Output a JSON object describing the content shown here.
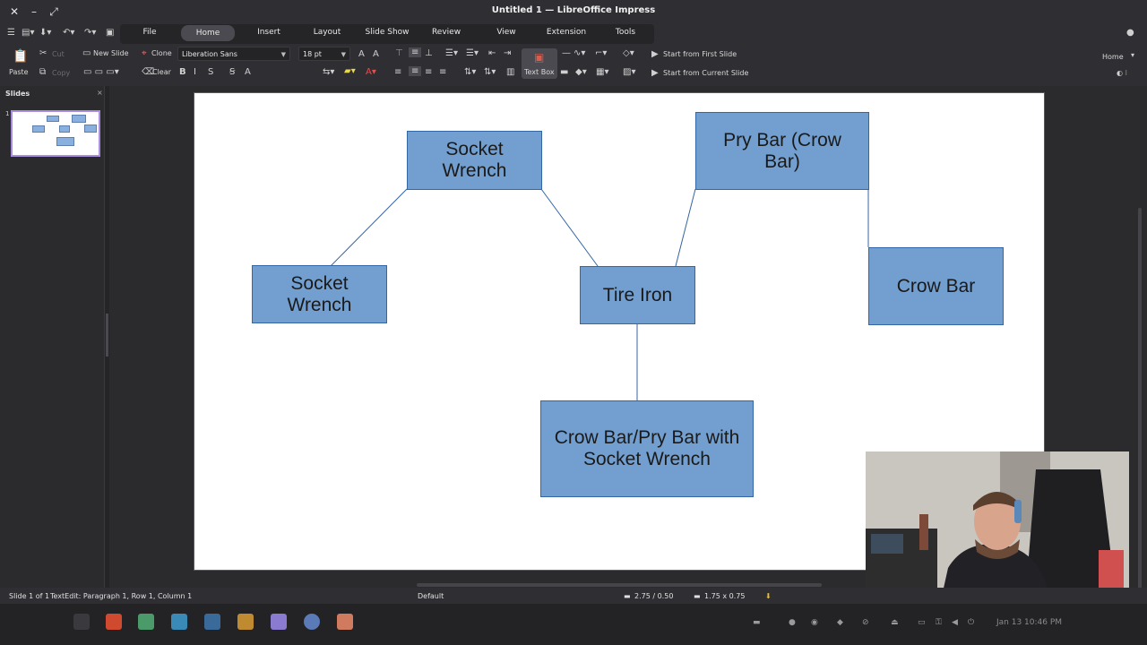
{
  "window": {
    "title": "Untitled 1 — LibreOffice Impress",
    "close": "✕",
    "minimize": "–",
    "maximize": "⤢"
  },
  "tabs": [
    "File",
    "Home",
    "Insert",
    "Layout",
    "Slide Show",
    "Review",
    "View",
    "Extension",
    "Tools"
  ],
  "active_tab": "Home",
  "ribbon": {
    "paste": "Paste",
    "cut": "Cut",
    "copy": "Copy",
    "new_slide": "New Slide",
    "clone": "Clone",
    "clear": "Clear",
    "font_name": "Liberation Sans",
    "font_size": "18 pt",
    "text_box": "Text Box",
    "start_first": "Start from First Slide",
    "start_current": "Start from Current Slide",
    "home_dropdown": "Home"
  },
  "slides_panel": {
    "title": "Slides",
    "close": "×",
    "slide_number": "1"
  },
  "slide": {
    "shapes": [
      {
        "text": "Socket Wrench"
      },
      {
        "text": "Pry Bar (Crow Bar)"
      },
      {
        "text": "Socket Wrench"
      },
      {
        "text": "Tire Iron"
      },
      {
        "text": "Crow Bar"
      },
      {
        "text": "Crow Bar/Pry Bar with Socket Wrench"
      }
    ]
  },
  "statusbar": {
    "slide_count": "Slide 1 of 1",
    "edit_info": "TextEdit: Paragraph 1, Row 1, Column 1",
    "layout": "Default",
    "position": "2.75 / 0.50",
    "size": "1.75 x 0.75"
  },
  "taskbar": {
    "clock": "Jan 13  10:46 PM"
  },
  "colors": {
    "shape_fill": "#729fcf",
    "shape_border": "#3465a4",
    "thumbnail_border": "#a98ee0",
    "textbox_icon": "#e05a4a"
  }
}
